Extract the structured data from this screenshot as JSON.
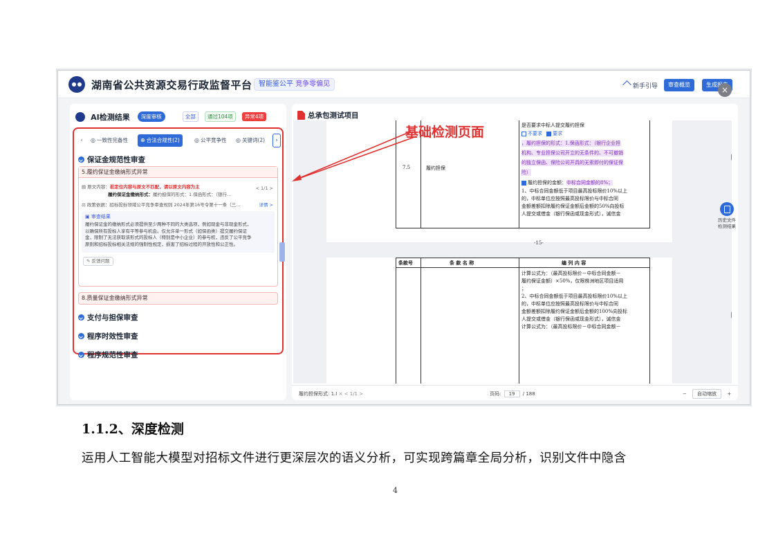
{
  "app": {
    "title": "湖南省公共资源交易行政监督平台",
    "slogan_part1": "智能鉴公平",
    "slogan_part2": "竞争零偏见",
    "guide_label": "新手引导",
    "overview_button": "审查概览",
    "generate_button": "生成报告",
    "close_icon": "×"
  },
  "left_panel": {
    "title": "AI检测结果",
    "deep_review": "深度审核",
    "filter_all": "全部",
    "filter_pass": "通过104项",
    "filter_error": "异常4项",
    "tabs": [
      {
        "icon": "◎",
        "label": "一致性完备性"
      },
      {
        "icon": "⊕",
        "label": "合法合规性(2)"
      },
      {
        "icon": "◎",
        "label": "公平竞争性"
      },
      {
        "icon": "◎",
        "label": "关键词(2)"
      }
    ],
    "section_main": "保证金规范性审查",
    "issue1": {
      "title": "5.履约保证金缴纳形式异常",
      "source_label": "原文内容：",
      "source_warning": "若定位内容与原文不匹配，请以原文内容为主",
      "source_pager": "< 1/1 >",
      "source_text_bold": "履约保证金缴纳形式：",
      "source_text": "履约担保的形式：1.保函形式：（银行…",
      "policy_label": "政策依据：",
      "policy_text": "招标投标领域公平竞争审查规则 2024年第16号令第十一条（三…",
      "detail_link": "详情 >",
      "result_title": "审查结果",
      "result_lines": [
        "履约保证金的缴纳形式必须提供至少两种不同的大类选项，例如现金与非现金形式，",
        "以确保所有投标人享有平等参与机会。仅允许单一形式（如保函类）提交履约保证",
        "金，限制了无法获取该形式的投标人（特别是中小企业）的参与权，违反了公平竞争",
        "原则和招标投标相关法规的强制性规定，损害了招标过程的开放性和公正性。"
      ],
      "feedback_button": "反馈问题"
    },
    "issue2_title": "8.质量保证金缴纳形式异常",
    "sections": [
      "支付与担保审查",
      "程序时效性审查",
      "程序规范性审查"
    ]
  },
  "document": {
    "title": "总承包测试项目",
    "annotation": "基础检测页面",
    "page1": {
      "clause_no": "7.5",
      "clause_name": "履约担保",
      "line_top": "是否要求中标人提交履约担保",
      "opt_no": "不要求",
      "opt_yes": "要求",
      "hl_lines": [
        "，履约担保的形式：1.保函形式：（银行企业担",
        "机构、专业担保公司开立的无条件的、不可撤销",
        "的独立保函、保险公司开具的无索即付的保证保",
        "险）"
      ],
      "amount_label": "履约担保的金额：",
      "amount_hl": "中标合同金额的8%；",
      "body_lines": [
        "1、中标合同金额低于项目最高投标限价10%以上",
        "的，中标单位应按照最高投标限价与中标合同",
        "金额差额扣除履约保证金额后金额的50%向投标",
        "人提交或借金（银行保函或现金形式），诚信金"
      ],
      "page_number": "-15-"
    },
    "page2": {
      "head_no": "条款号",
      "head_name": "条 款 名 称",
      "head_content": "编 列 内 容",
      "lines": [
        "计算公式为：（最高投标限价－中标合同金额－",
        "履约保证金额）×50%，仅限株洲地区项目适用",
        "；",
        "2、中标合同金额低于项目最高投标限价10%以上",
        "的，中标单位应按照最高投标限价与中标合同",
        "金额差额扣除履约保证金额后金额的100%向投标",
        "人提交或借金（银行保函或现金形式），诚信金",
        "计算公式为：（最高投标限价－中标合同金额－"
      ]
    },
    "footer": {
      "match_label": "履约担保形式: 1.I",
      "match_pager": "× < 1/1 >",
      "page_label": "页码:",
      "page_current": "19",
      "page_total": "/ 188",
      "zoom_minus": "−",
      "zoom_label": "自动缩放",
      "zoom_plus": "+"
    },
    "history_label_1": "历史文件",
    "history_label_2": "检测结果"
  },
  "body": {
    "heading": "1.1.2、深度检测",
    "paragraph": "运用人工智能大模型对招标文件进行更深层次的语义分析，可实现跨篇章全局分析，识别文件中隐含",
    "page_number": "4"
  }
}
